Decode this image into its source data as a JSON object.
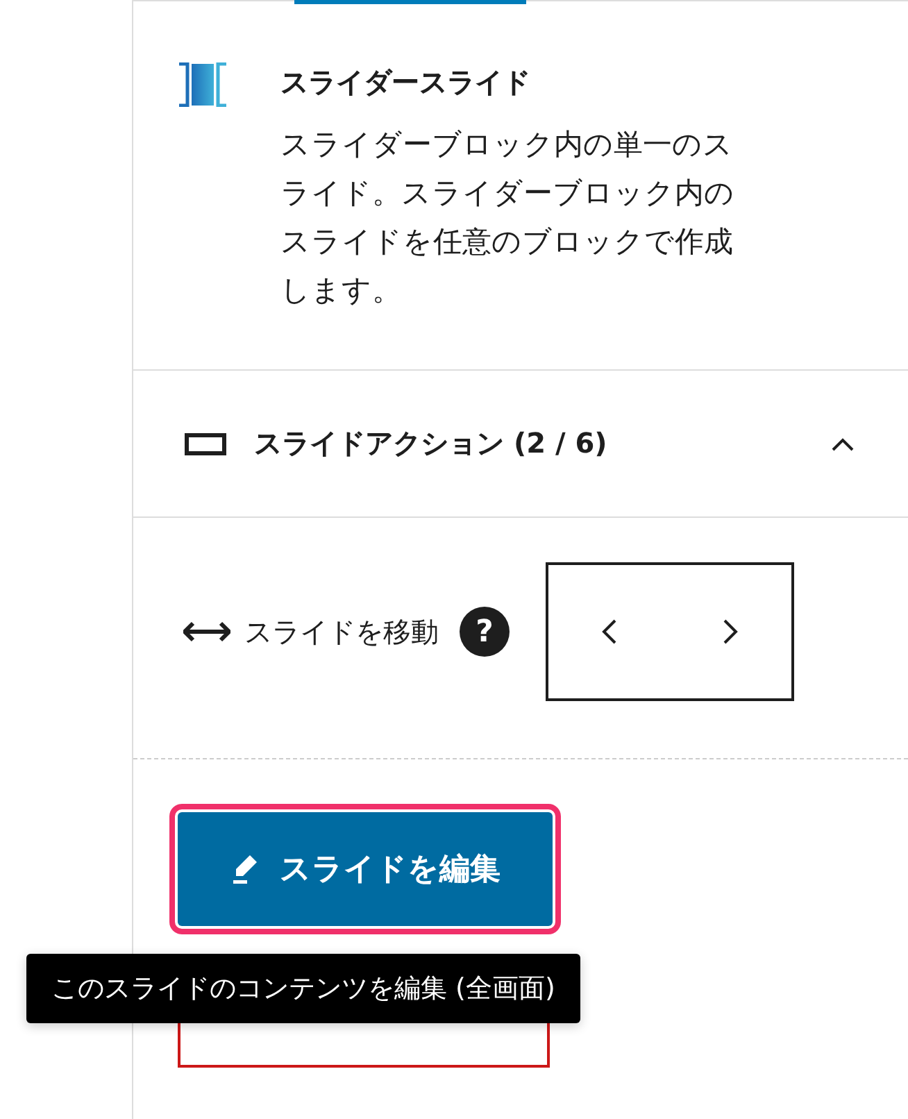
{
  "block_card": {
    "title": "スライダースライド",
    "description": "スライダーブロック内の単一のスライド。スライダーブロック内のスライドを任意のブロックで作成します。"
  },
  "panel": {
    "title": "スライドアクション (2 / 6)",
    "expanded": true,
    "move_label": "スライドを移動",
    "help": "?"
  },
  "edit_button": {
    "label": "スライドを編集",
    "focused": true
  },
  "delete_button": {
    "kind": "danger"
  },
  "tooltip": "このスライドのコンテンツを編集 (全画面)"
}
